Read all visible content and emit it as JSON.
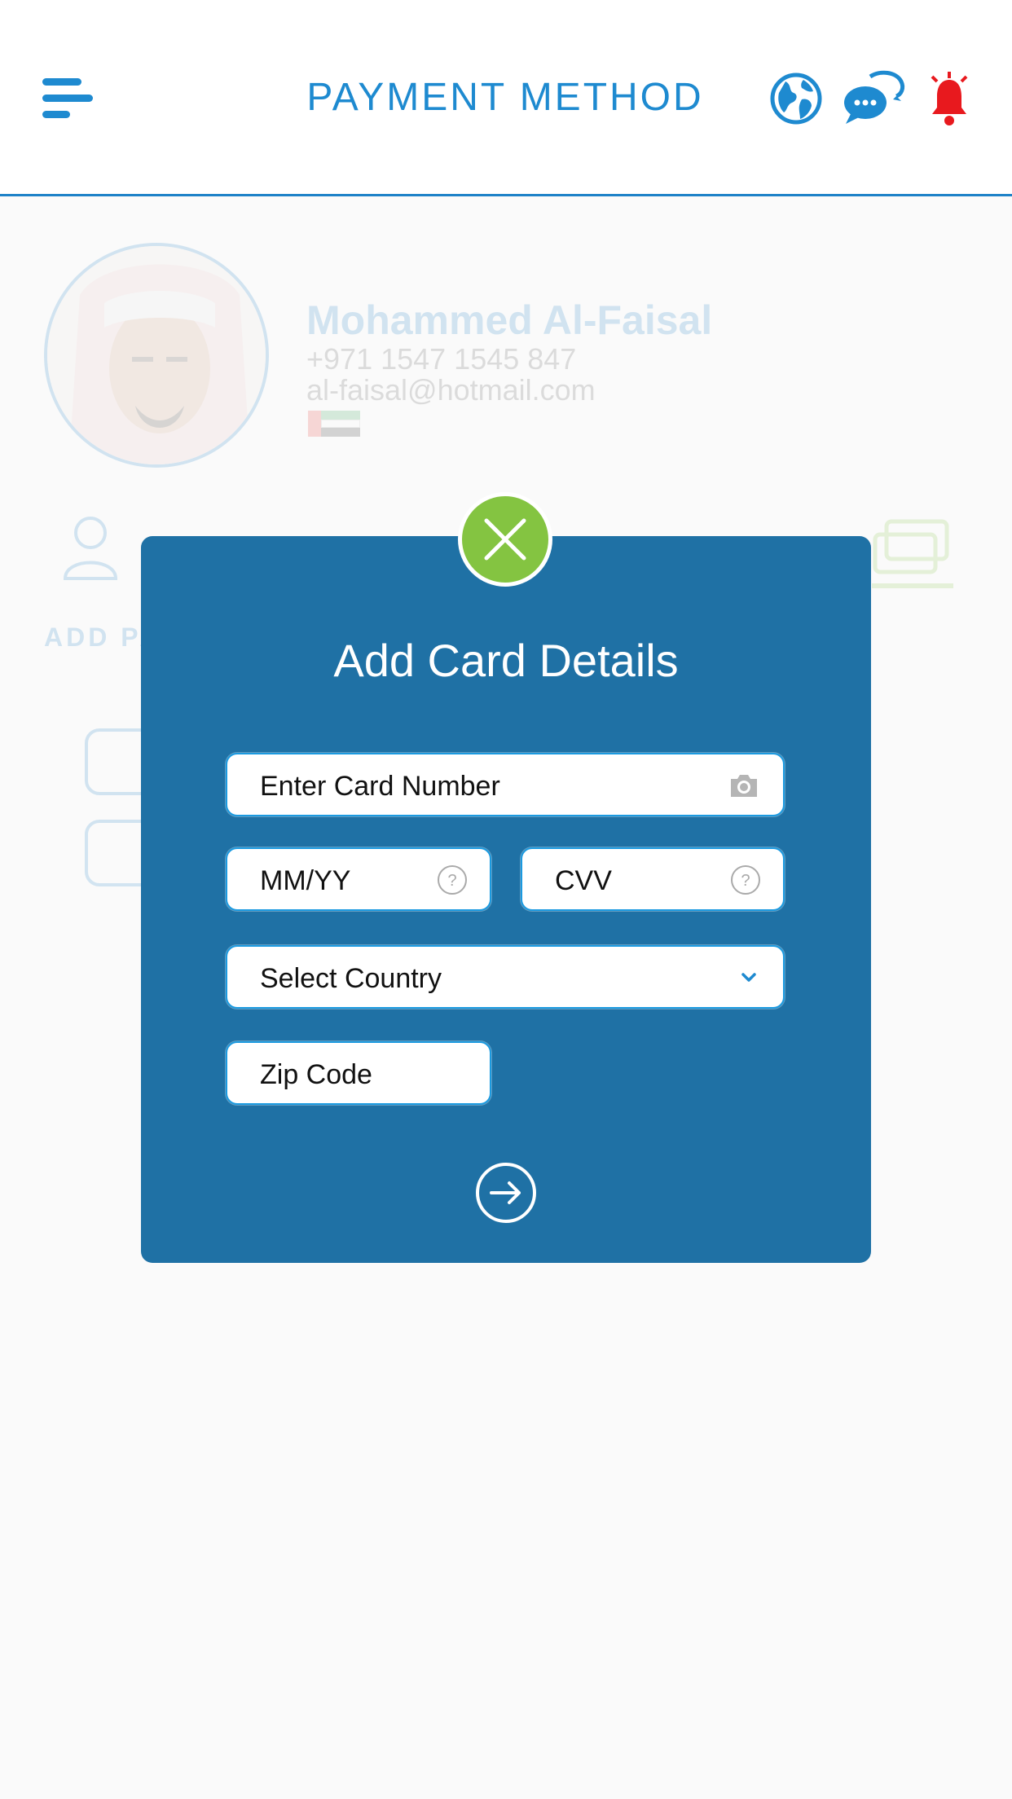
{
  "header": {
    "title": "PAYMENT METHOD",
    "icons": [
      "menu-icon",
      "globe-icon",
      "chat-icon",
      "bell-icon"
    ]
  },
  "profile": {
    "name": "Mohammed Al-Faisal",
    "phone": "+971 1547 1545 847",
    "email": "al-faisal@hotmail.com",
    "step_label": "ADD PA"
  },
  "modal": {
    "title": "Add Card Details",
    "card_number_placeholder": "Enter Card Number",
    "expiry_placeholder": "MM/YY",
    "cvv_placeholder": "CVV",
    "country_placeholder": "Select Country",
    "zip_placeholder": "Zip Code"
  },
  "colors": {
    "primary": "#1e8ad0",
    "modal_bg": "#1f71a5",
    "close_green": "#84c441",
    "bell_red": "#e8191e"
  }
}
